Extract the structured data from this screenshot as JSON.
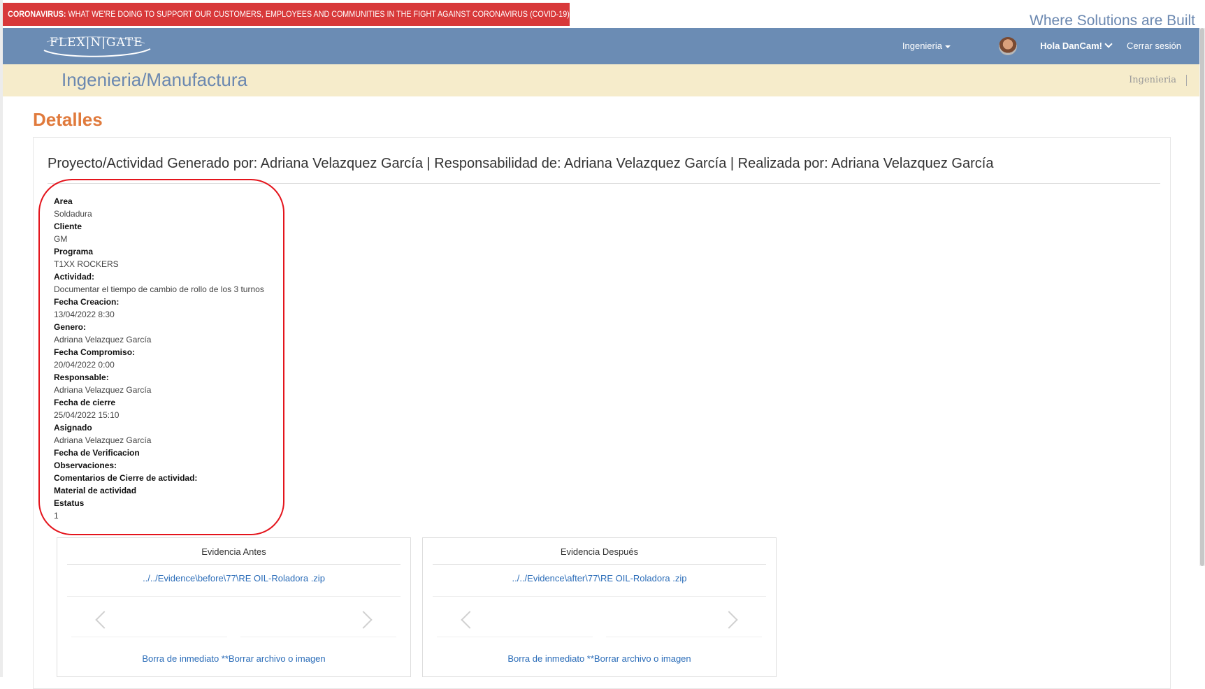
{
  "banner": {
    "covid_label": "CORONAVIRUS:",
    "covid_text": " WHAT WE'RE DOING TO SUPPORT OUR CUSTOMERS, EMPLOYEES AND COMMUNITIES IN THE FIGHT AGAINST CORONAVIRUS (COVID-19)",
    "tagline": "Where Solutions are Built"
  },
  "navbar": {
    "logo": "FLEX|N|GATE",
    "ingenieria": "Ingenieria",
    "user_greeting": "Hola DanCam!",
    "logout": "Cerrar sesión"
  },
  "subheader": {
    "title": "Ingenieria/Manufactura",
    "link": "Ingenieria"
  },
  "page": {
    "section_title": "Detalles",
    "heading": "Proyecto/Actividad Generado por: Adriana Velazquez García | Responsabilidad de: Adriana Velazquez García | Realizada por: Adriana Velazquez García"
  },
  "details": [
    {
      "label": "Area",
      "value": "Soldadura"
    },
    {
      "label": "Cliente",
      "value": "GM"
    },
    {
      "label": "Programa",
      "value": "T1XX ROCKERS"
    },
    {
      "label": "Actividad:",
      "value": "Documentar el tiempo de cambio de rollo de los 3 turnos"
    },
    {
      "label": "Fecha Creacion:",
      "value": "13/04/2022 8:30"
    },
    {
      "label": "Genero:",
      "value": "Adriana Velazquez García"
    },
    {
      "label": "Fecha Compromiso:",
      "value": "20/04/2022 0:00"
    },
    {
      "label": "Responsable:",
      "value": "Adriana Velazquez García"
    },
    {
      "label": "Fecha de cierre",
      "value": "25/04/2022 15:10"
    },
    {
      "label": "Asignado",
      "value": "Adriana Velazquez García"
    },
    {
      "label": "Fecha de Verificacion",
      "value": ""
    },
    {
      "label": "Observaciones:",
      "value": ""
    },
    {
      "label": "Comentarios de Cierre de actividad:",
      "value": ""
    },
    {
      "label": "Material de actividad",
      "value": ""
    },
    {
      "label": "Estatus",
      "value": "1"
    }
  ],
  "evidence": {
    "before": {
      "title": "Evidencia Antes",
      "file": "../../Evidence\\before\\77\\RE OIL-Roladora .zip",
      "delete": "Borra de inmediato **Borrar archivo o imagen"
    },
    "after": {
      "title": "Evidencia Después",
      "file": "../../Evidence\\after\\77\\RE OIL-Roladora .zip",
      "delete": "Borra de inmediato **Borrar archivo o imagen"
    }
  }
}
